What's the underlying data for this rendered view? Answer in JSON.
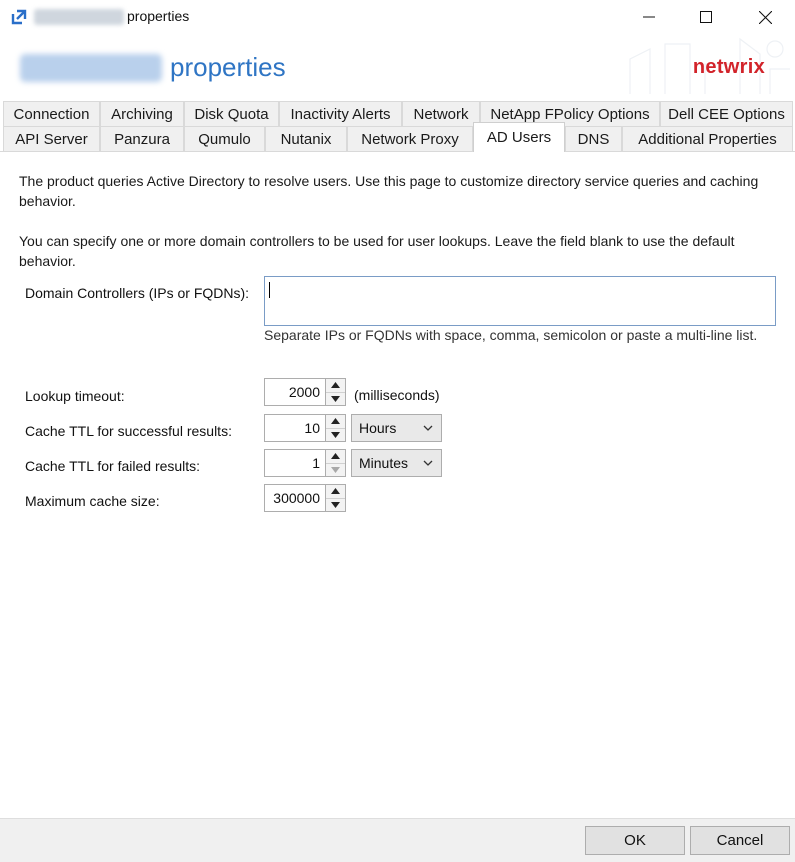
{
  "window": {
    "title_suffix": "properties",
    "header_title": "properties",
    "brand": "netwrix"
  },
  "tabs": {
    "row1": [
      "Connection",
      "Archiving",
      "Disk Quota",
      "Inactivity Alerts",
      "Network",
      "NetApp FPolicy Options",
      "Dell CEE Options"
    ],
    "row2": [
      "API Server",
      "Panzura",
      "Qumulo",
      "Nutanix",
      "Network Proxy",
      "AD Users",
      "DNS",
      "Additional Properties"
    ],
    "active": "AD Users"
  },
  "panel": {
    "intro": "The product queries Active Directory to resolve users. Use this page to customize directory service queries and caching behavior.",
    "dc_intro": "You can specify one or more domain controllers to be used for user lookups. Leave the field blank to use the default behavior.",
    "dc_label": "Domain Controllers (IPs or FQDNs):",
    "dc_value": "",
    "dc_hint": "Separate IPs or FQDNs with space, comma, semicolon or paste a multi-line list.",
    "lookup_label": "Lookup timeout:",
    "lookup_value": "2000",
    "lookup_units": "(milliseconds)",
    "success_label": "Cache TTL for successful results:",
    "success_value": "10",
    "success_unit": "Hours",
    "failed_label": "Cache TTL for failed results:",
    "failed_value": "1",
    "failed_unit": "Minutes",
    "max_label": "Maximum cache size:",
    "max_value": "300000"
  },
  "buttons": {
    "ok": "OK",
    "cancel": "Cancel"
  }
}
